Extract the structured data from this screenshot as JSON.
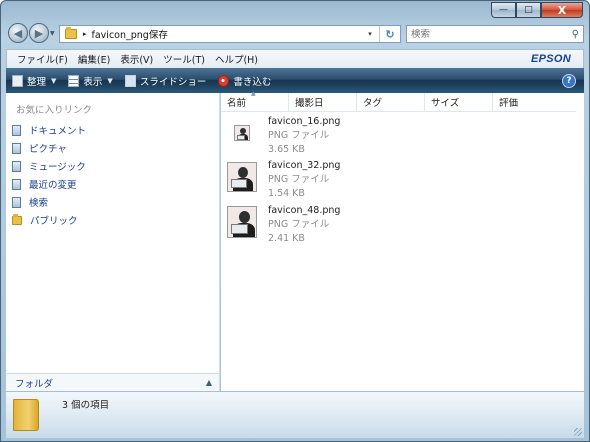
{
  "window": {
    "caption_buttons": {
      "minimize": "—",
      "maximize": "□",
      "close": "X"
    }
  },
  "address": {
    "path": "favicon_png保存",
    "crumb_arrow": "▸",
    "dropdown": "▾",
    "refresh": "↻"
  },
  "search": {
    "placeholder": "検索",
    "icon": "search-icon"
  },
  "menu": {
    "items": [
      "ファイル(F)",
      "編集(E)",
      "表示(V)",
      "ツール(T)",
      "ヘルプ(H)"
    ],
    "brand": "EPSON"
  },
  "toolbar": {
    "organize": "整理",
    "views": "表示",
    "slideshow": "スライドショー",
    "burn": "書き込む",
    "help": "?"
  },
  "nav": {
    "heading": "お気に入りリンク",
    "favorites": [
      "ドキュメント",
      "ピクチャ",
      "ミュージック",
      "最近の変更",
      "検索",
      "パブリック"
    ],
    "folders_label": "フォルダ",
    "folders_chevron": "▲"
  },
  "columns": [
    "名前",
    "撮影日",
    "タグ",
    "サイズ",
    "評価"
  ],
  "files": [
    {
      "name": "favicon_16.png",
      "type": "PNG ファイル",
      "size": "3.65 KB"
    },
    {
      "name": "favicon_32.png",
      "type": "PNG ファイル",
      "size": "1.54 KB"
    },
    {
      "name": "favicon_48.png",
      "type": "PNG ファイル",
      "size": "2.41 KB"
    }
  ],
  "status": {
    "count": "3 個の項目"
  }
}
